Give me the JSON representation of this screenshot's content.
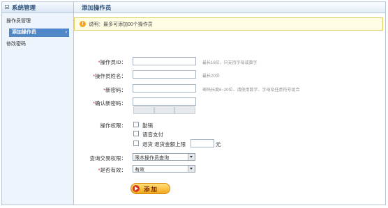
{
  "sidebar": {
    "title": "系统管理",
    "items": [
      {
        "label": "操作员管理"
      },
      {
        "label": "添加操作员"
      },
      {
        "label": "修改密码"
      }
    ]
  },
  "page": {
    "title": "添加操作员"
  },
  "notice": {
    "text": "说明：最多可添加00个操作员"
  },
  "form": {
    "operator_id": {
      "label": "操作员ID：",
      "hint": "最长16位，只支持字母或数字",
      "value": ""
    },
    "operator_name": {
      "label": "操作员姓名：",
      "hint": "最长20位",
      "value": ""
    },
    "new_password": {
      "label": "新密码：",
      "hint": "密码长度6~20位，请使用数字、字母及任意符号组合",
      "value": ""
    },
    "confirm_password": {
      "label": "确认新密码：",
      "value": ""
    },
    "permissions": {
      "label": "操作权限：",
      "options": [
        {
          "label": "勤销"
        },
        {
          "label": "语音支付"
        },
        {
          "label": "退货 退货金额上限"
        }
      ],
      "unit": "元",
      "limit_value": ""
    },
    "query_permission": {
      "label": "查询交易权限：",
      "value": "限本操作员查询"
    },
    "is_valid": {
      "label": "是否有效：",
      "value": "有效"
    },
    "submit_label": "添加"
  },
  "colors": {
    "accent": "#4f87c7",
    "required": "#d12b2b",
    "button": "#f5a71c"
  }
}
